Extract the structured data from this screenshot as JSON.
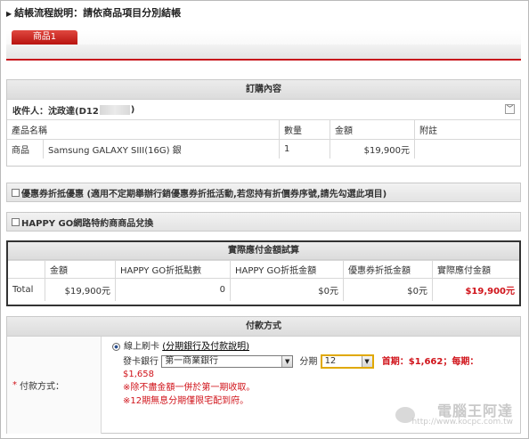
{
  "header": {
    "title": "結帳流程說明：請依商品項目分別結帳"
  },
  "tabs": [
    {
      "label": "商品1"
    }
  ],
  "order": {
    "section_title": "訂購內容",
    "recipient_label": "收件人：沈政達(D12",
    "recipient_suffix": ")",
    "columns": [
      "產品名稱",
      "數量",
      "金額",
      "附註"
    ],
    "items": [
      {
        "type": "商品",
        "name": "Samsung GALAXY SIII(16G) 銀",
        "qty": "1",
        "amount": "$19,900元",
        "note": ""
      }
    ]
  },
  "coupon": {
    "label": "優惠券折抵優惠 (適用不定期舉辦行銷優惠券折抵活動,若您持有折價券序號,請先勾選此項目)"
  },
  "happygo": {
    "label": "HAPPY GO網路特約商商品兌換"
  },
  "calc": {
    "title": "實際應付金額試算",
    "columns": [
      "金額",
      "HAPPY GO折抵點數",
      "HAPPY GO折抵金額",
      "優惠券折抵金額",
      "實際應付金額"
    ],
    "row": {
      "label": "Total",
      "amount": "$19,900元",
      "points": "0",
      "hg_amount": "$0元",
      "coupon_amount": "$0元",
      "pay": "$19,900元"
    }
  },
  "payment": {
    "title": "付款方式",
    "field_label": "付款方式：",
    "option_label": "線上刷卡",
    "option_link": "(分期銀行及付款說明)",
    "bank_label": "發卡銀行",
    "bank_value": "第一商業銀行",
    "period_label": "分期",
    "period_value": "12",
    "installment_text": "首期：$1,662；每期：",
    "installment_text2": "$1,658",
    "note1": "※除不盡金額一併於第一期收取。",
    "note2": "※12期無息分期僅限宅配到府。"
  },
  "watermark": {
    "line1": "電腦王阿達",
    "line2": "http://www.kocpc.com.tw"
  },
  "colors": {
    "accent": "#c8151c",
    "highlight_border": "#e0a800",
    "price_red": "#d0131a"
  }
}
